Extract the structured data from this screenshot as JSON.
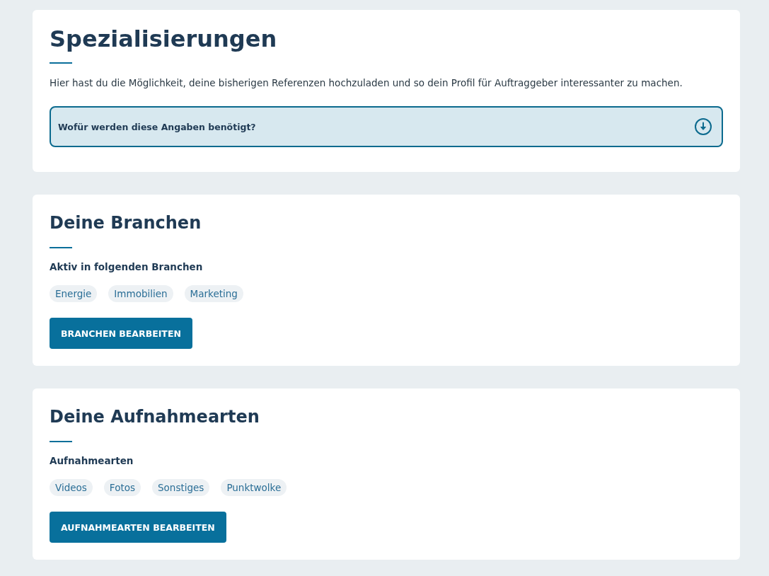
{
  "sections": [
    {
      "kind": "intro",
      "title": "Spezialisierungen",
      "description": "Hier hast du die Möglichkeit, deine bisherigen Referenzen hochzuladen und so dein Profil für Auftraggeber interessanter zu machen.",
      "accordion": {
        "label": "Wofür werden diese Angaben benötigt?",
        "expanded": false
      }
    },
    {
      "kind": "tags",
      "title": "Deine Branchen",
      "label": "Aktiv in folgenden Branchen",
      "tags": [
        "Energie",
        "Immobilien",
        "Marketing"
      ],
      "button": "BRANCHEN BEARBEITEN"
    },
    {
      "kind": "tags",
      "title": "Deine Aufnahmearten",
      "label": "Aufnahmearten",
      "tags": [
        "Videos",
        "Fotos",
        "Sonstiges",
        "Punktwolke"
      ],
      "button": "AUFNAHMEARTEN BEARBEITEN"
    }
  ]
}
